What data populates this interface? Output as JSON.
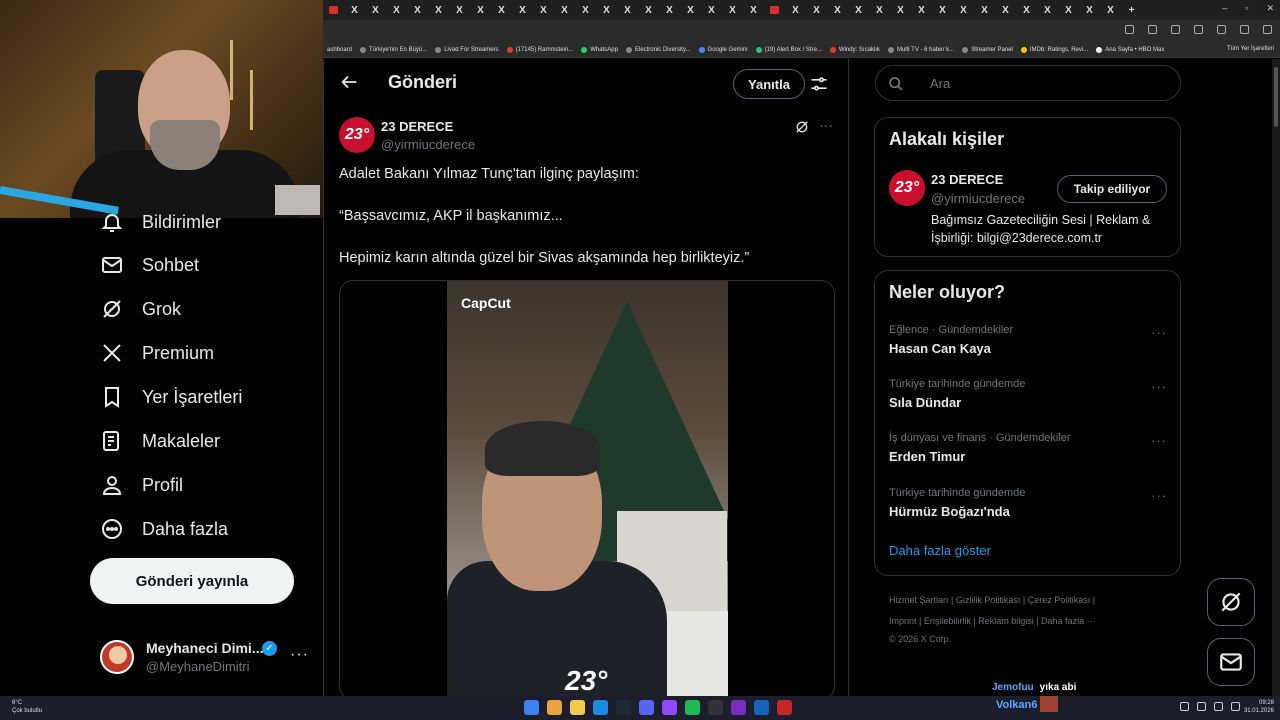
{
  "browser": {
    "tab_glyph": "X",
    "new_tab": "+",
    "window_controls": [
      "–",
      "▫",
      "✕"
    ],
    "bookmarks": [
      "ashboard",
      "Türkiye'nin En Büyü...",
      "Livad For Streamers",
      "(17145) Rammstein...",
      "WhatsApp",
      "Electronic Diversity...",
      "Google Gemini",
      "(19) Alert Box / Stre...",
      "Windy: Sıcaklık",
      "Multi TV - 6 haber k...",
      "Streamer Panel",
      "IMDb: Ratings, Revi...",
      "Ana Sayfa • HBO Max"
    ],
    "bookmarks_folder": "Tüm Yer İşaretleri"
  },
  "nav": {
    "items": [
      {
        "label": "Bildirimler",
        "icon": "bell-icon"
      },
      {
        "label": "Sohbet",
        "icon": "mail-icon"
      },
      {
        "label": "Grok",
        "icon": "grok-icon"
      },
      {
        "label": "Premium",
        "icon": "x-logo-icon"
      },
      {
        "label": "Yer İşaretleri",
        "icon": "bookmark-icon"
      },
      {
        "label": "Makaleler",
        "icon": "article-icon"
      },
      {
        "label": "Profil",
        "icon": "person-icon"
      },
      {
        "label": "Daha fazla",
        "icon": "more-circle-icon"
      }
    ],
    "post_button": "Gönderi yayınla",
    "account": {
      "name": "Meyhaneci Dimi...",
      "handle": "@MeyhaneDimitri",
      "verified": "✓",
      "more": "···"
    }
  },
  "main": {
    "title": "Gönderi",
    "reply_button": "Yanıtla",
    "tweet": {
      "avatar_text": "23°",
      "author": "23 DERECE",
      "handle": "@yirmiucderece",
      "more": "···",
      "lines": [
        "Adalet Bakanı Yılmaz Tunç'tan ilginç paylaşım:",
        "“Başsavcımız, AKP il başkanımız...",
        "Hepimiz karın altında güzel bir Sivas akşamında hep birlikteyiz.”"
      ],
      "video_watermark": "CapCut",
      "video_logo": "23°"
    }
  },
  "right": {
    "search_placeholder": "Ara",
    "related": {
      "title": "Alakalı kişiler",
      "avatar_text": "23°",
      "name": "23 DERECE",
      "handle": "@yirmiucderece",
      "follow_button": "Takip ediliyor",
      "bio": "Bağımsız Gazeteciliğin Sesi | Reklam & İşbirliği: bilgi@23derece.com.tr"
    },
    "trends": {
      "title": "Neler oluyor?",
      "items": [
        {
          "category": "Eğlence · Gündemdekiler",
          "name": "Hasan Can Kaya",
          "more": "···"
        },
        {
          "category": "Türkiye tarihinde gündemde",
          "name": "Sıla Dündar",
          "more": "···"
        },
        {
          "category": "İş dünyası ve finans · Gündemdekiler",
          "name": "Erden Timur",
          "more": "···"
        },
        {
          "category": "Türkiye tarihinde gündemde",
          "name": "Hürmüz Boğazı'nda",
          "more": "···"
        }
      ],
      "show_more": "Daha fazla göster"
    },
    "footer": {
      "line1": "Hizmet Şartları  |  Gizlilik Politikası  |  Çerez Politikası  |",
      "line2": "Imprint  |  Erişilebilirlik  |  Reklam bilgisi  |  Daha fazla ···",
      "line3": "© 2026 X Corp."
    }
  },
  "stream_chat": {
    "user": "Jemofuu",
    "message": "yıka abi"
  },
  "taskbar": {
    "weather_temp": "6°C",
    "weather_desc": "Çok bulutlu",
    "stream_user": "Volkan6",
    "time": "09:28",
    "date": "31.01.2026"
  },
  "colors": {
    "accent": "#1d9bf0",
    "brand_red": "#c8102e",
    "bg": "#000000",
    "border": "#2f3336"
  }
}
